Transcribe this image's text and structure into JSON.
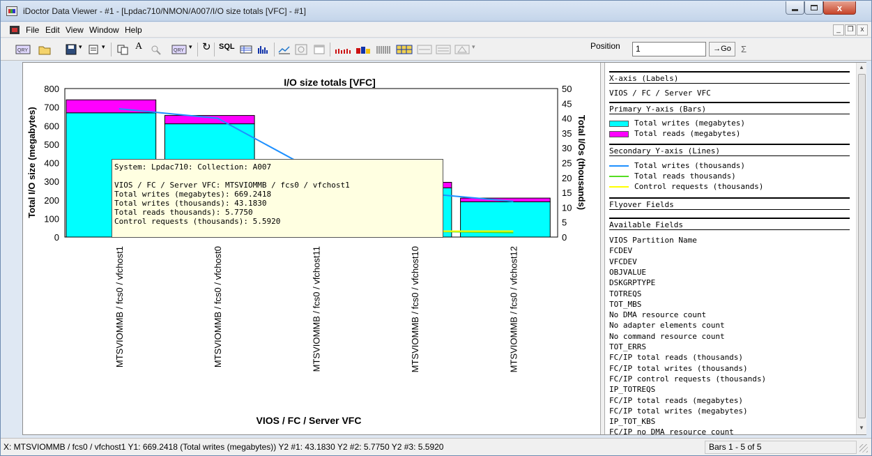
{
  "window": {
    "title": "iDoctor Data Viewer - #1 - [Lpdac710/NMON/A007/I/O size totals [VFC] - #1]",
    "close_label": "x"
  },
  "menubar": {
    "items": [
      "File",
      "Edit",
      "View",
      "Window",
      "Help"
    ],
    "mdi_min": "_",
    "mdi_restore": "❐",
    "mdi_close": "x"
  },
  "toolbar": {
    "sql_label": "SQL",
    "font_label": "A",
    "position_label": "Position",
    "position_value": "1",
    "go_label": "→Go",
    "sum_label": "Σ"
  },
  "chart_data": {
    "type": "bar",
    "title": "I/O size totals [VFC]",
    "xlabel": "VIOS / FC / Server VFC",
    "ylabel": "Total I/O size (megabytes)",
    "y2label": "Total I/Os (thousands)",
    "ylim": [
      0,
      800
    ],
    "y2lim": [
      0,
      50
    ],
    "yticks": [
      "0",
      "100",
      "200",
      "300",
      "400",
      "500",
      "600",
      "700",
      "800"
    ],
    "y2ticks": [
      "0",
      "5",
      "10",
      "15",
      "20",
      "25",
      "30",
      "35",
      "40",
      "45",
      "50"
    ],
    "categories": [
      "MTSVIOMMB / fcs0 / vfchost1",
      "MTSVIOMMB / fcs0 / vfchost0",
      "MTSVIOMMB / fcs0 / vfchost11",
      "MTSVIOMMB / fcs0 / vfchost10",
      "MTSVIOMMB / fcs0 / vfchost12"
    ],
    "series": [
      {
        "name": "Total writes (megabytes)",
        "axis": "primary",
        "kind": "bar",
        "color": "#00ffff",
        "values": [
          669.2418,
          610,
          275,
          265,
          190
        ]
      },
      {
        "name": "Total reads (megabytes)",
        "axis": "primary",
        "kind": "bar",
        "color": "#ff00ff",
        "values": [
          70,
          45,
          0,
          30,
          20
        ]
      },
      {
        "name": "Total writes (thousands)",
        "axis": "secondary",
        "kind": "line",
        "color": "#1e90ff",
        "values": [
          43.183,
          40,
          22,
          15,
          12
        ]
      },
      {
        "name": "Total reads thousands)",
        "axis": "secondary",
        "kind": "line",
        "color": "#55dd22",
        "values": [
          5.775,
          4,
          2,
          2,
          1.5
        ]
      },
      {
        "name": "Control requests (thousands)",
        "axis": "secondary",
        "kind": "line",
        "color": "#ffff00",
        "values": [
          5.592,
          4,
          2,
          2,
          2
        ]
      }
    ]
  },
  "tooltip": {
    "lines": [
      "System: Lpdac710:  Collection: A007",
      "",
      "VIOS / FC / Server VFC: MTSVIOMMB / fcs0 / vfchost1",
      "Total writes (megabytes): 669.2418",
      "Total writes (thousands): 43.1830",
      "Total reads thousands): 5.7750",
      "Control requests (thousands): 5.5920"
    ]
  },
  "legend": {
    "xaxis_header": "X-axis (Labels)",
    "xaxis_value": "VIOS / FC / Server VFC",
    "primary_header": "Primary Y-axis (Bars)",
    "primary_items": [
      {
        "label": "Total writes (megabytes)",
        "color": "#00ffff"
      },
      {
        "label": "Total reads (megabytes)",
        "color": "#ff00ff"
      }
    ],
    "secondary_header": "Secondary Y-axis (Lines)",
    "secondary_items": [
      {
        "label": "Total writes (thousands)",
        "color": "#1e90ff"
      },
      {
        "label": "Total reads thousands)",
        "color": "#55dd22"
      },
      {
        "label": "Control requests (thousands)",
        "color": "#ffff00"
      }
    ],
    "flyover_header": "Flyover Fields",
    "available_header": "Available Fields",
    "available_fields": [
      "VIOS Partition Name",
      "FCDEV",
      "VFCDEV",
      "OBJVALUE",
      "DSKGRPTYPE",
      "TOTREQS",
      "TOT_MBS",
      "No DMA resource count",
      "No adapter elements count",
      "No command resource count",
      "TOT_ERRS",
      "FC/IP total reads (thousands)",
      "FC/IP total writes (thousands)",
      "FC/IP control requests (thousands)",
      "IP_TOTREQS",
      "FC/IP total reads (megabytes)",
      "FC/IP total writes (megabytes)",
      "IP_TOT_KBS",
      "FC/IP no DMA resource count"
    ]
  },
  "statusbar": {
    "text": "X: MTSVIOMMB / fcs0 / vfchost1   Y1: 669.2418 (Total writes (megabytes))    Y2 #1: 43.1830   Y2 #2: 5.7750   Y2 #3: 5.5920",
    "bars": "Bars 1 - 5 of 5"
  }
}
